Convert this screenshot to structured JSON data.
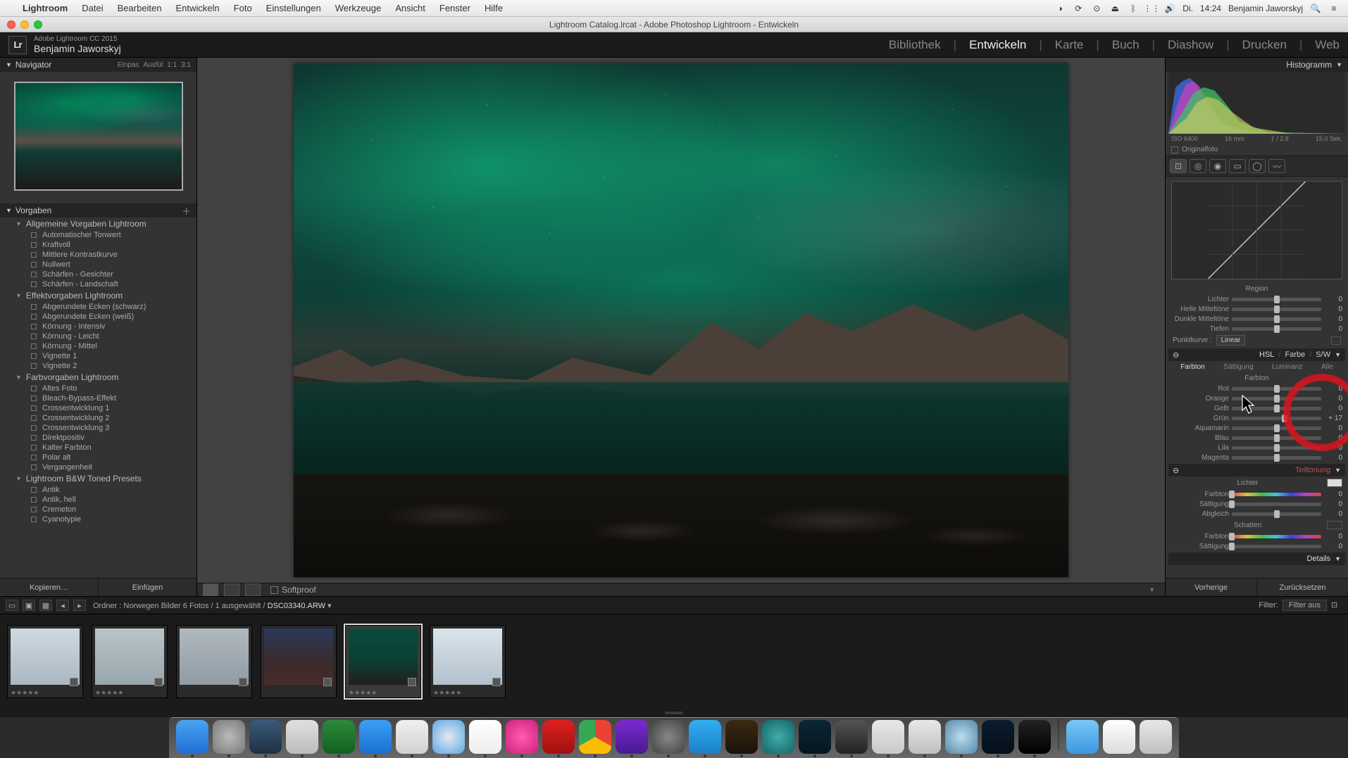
{
  "mac_menu": {
    "app": "Lightroom",
    "items": [
      "Datei",
      "Bearbeiten",
      "Entwickeln",
      "Foto",
      "Einstellungen",
      "Werkzeuge",
      "Ansicht",
      "Fenster",
      "Hilfe"
    ],
    "right": {
      "day": "Di.",
      "time": "14:24",
      "user": "Benjamin Jaworskyj"
    }
  },
  "window_title": "Lightroom Catalog.lrcat - Adobe Photoshop Lightroom - Entwickeln",
  "identity": {
    "line1": "Adobe Lightroom CC 2015",
    "line2": "Benjamin Jaworskyj",
    "logo_text": "Lr"
  },
  "modules": {
    "items": [
      "Bibliothek",
      "Entwickeln",
      "Karte",
      "Buch",
      "Diashow",
      "Drucken",
      "Web"
    ],
    "active": "Entwickeln"
  },
  "left": {
    "navigator_title": "Navigator",
    "zoom_labels": [
      "Einpas",
      "Ausfül",
      "1:1",
      "3:1"
    ],
    "presets_title": "Vorgaben",
    "groups": [
      {
        "name": "Allgemeine Vorgaben Lightroom",
        "items": [
          "Automatischer Tonwert",
          "Kraftvoll",
          "Mittlere Kontrastkurve",
          "Nullwert",
          "Schärfen - Gesichter",
          "Schärfen - Landschaft"
        ]
      },
      {
        "name": "Effektvorgaben Lightroom",
        "items": [
          "Abgerundete Ecken (schwarz)",
          "Abgerundete Ecken (weiß)",
          "Körnung - Intensiv",
          "Körnung - Leicht",
          "Körnung - Mittel",
          "Vignette 1",
          "Vignette 2"
        ]
      },
      {
        "name": "Farbvorgaben Lightroom",
        "items": [
          "Altes Foto",
          "Bleach-Bypass-Effekt",
          "Crossentwicklung 1",
          "Crossentwicklung 2",
          "Crossentwicklung 3",
          "Direktpositiv",
          "Kalter Farbton",
          "Polar alt",
          "Vergangenheit"
        ]
      },
      {
        "name": "Lightroom B&W Toned Presets",
        "items": [
          "Antik",
          "Antik, hell",
          "Cremeton",
          "Cyanotypie"
        ]
      }
    ],
    "btn_copy": "Kopieren…",
    "btn_paste": "Einfügen"
  },
  "center": {
    "softproof": "Softproof"
  },
  "path_bar": {
    "path_prefix": "Ordner : Norwegen Bilder  6 Fotos / 1 ausgewählt /",
    "filename": "DSC03340.ARW",
    "filter_label": "Filter:",
    "filter_value": "Filter aus"
  },
  "right": {
    "histogram_title": "Histogramm",
    "histo_info": {
      "iso": "ISO 6400",
      "focal": "16 mm",
      "aperture": "ƒ / 2.8",
      "shutter": "15,0 Sek."
    },
    "original_label": "Originalfoto",
    "tone_curve": {
      "region_title": "Region",
      "rows": [
        {
          "label": "Lichter",
          "val": "0"
        },
        {
          "label": "Helle Mitteltöne",
          "val": "0"
        },
        {
          "label": "Dunkle Mitteltöne",
          "val": "0"
        },
        {
          "label": "Tiefen",
          "val": "0"
        }
      ],
      "pk_label": "Punktkurve :",
      "pk_value": "Linear"
    },
    "hsl": {
      "header": {
        "hsl": "HSL",
        "farbe": "Farbe",
        "sw": "S/W"
      },
      "tabs": [
        "Farbton",
        "Sättigung",
        "Luminanz",
        "Alle"
      ],
      "active_tab": "Farbton",
      "sub_title": "Farbton",
      "rows": [
        {
          "label": "Rot",
          "val": "0",
          "cls": "hue-track-rot",
          "pos": 50
        },
        {
          "label": "Orange",
          "val": "0",
          "cls": "hue-track-orange",
          "pos": 50
        },
        {
          "label": "Gelb",
          "val": "0",
          "cls": "hue-track-gelb",
          "pos": 50
        },
        {
          "label": "Grün",
          "val": "+ 17",
          "cls": "hue-track-gruen",
          "pos": 59
        },
        {
          "label": "Aquamarin",
          "val": "0",
          "cls": "hue-track-aqua",
          "pos": 50
        },
        {
          "label": "Blau",
          "val": "0",
          "cls": "hue-track-blau",
          "pos": 50
        },
        {
          "label": "Lila",
          "val": "0",
          "cls": "hue-track-lila",
          "pos": 50
        },
        {
          "label": "Magenta",
          "val": "0",
          "cls": "hue-track-magenta",
          "pos": 50
        }
      ]
    },
    "split": {
      "header": "Teiltonung",
      "lights_title": "Lichter",
      "shadows_title": "Schatten",
      "hue_label": "Farbton",
      "sat_label": "Sättigung",
      "balance_label": "Abgleich",
      "zero": "0"
    },
    "details_header": "Details",
    "btn_prev": "Vorherige",
    "btn_reset": "Zurücksetzen"
  },
  "dock": {
    "apps": [
      {
        "name": "finder",
        "bg": "linear-gradient(#4aa3f0,#1f6fd6)"
      },
      {
        "name": "launchpad",
        "bg": "radial-gradient(circle at 50% 50%, #bbb, #777)"
      },
      {
        "name": "quicktime",
        "bg": "linear-gradient(#3a5a7a,#203040)"
      },
      {
        "name": "calculator",
        "bg": "linear-gradient(#e0e0e0,#bcbcbc)"
      },
      {
        "name": "excel",
        "bg": "linear-gradient(#2a8a3a,#126020)"
      },
      {
        "name": "appstore",
        "bg": "linear-gradient(#3aa0f5,#1a6ed0)"
      },
      {
        "name": "textedit",
        "bg": "linear-gradient(#f0f0f0,#d0d0d0)"
      },
      {
        "name": "safari",
        "bg": "radial-gradient(circle at 50% 50%, #e8e8ee, #5aa8e8)"
      },
      {
        "name": "calendar",
        "bg": "linear-gradient(#fff,#eee)"
      },
      {
        "name": "itunes",
        "bg": "radial-gradient(circle at 50% 50%, #ff5caa, #d02080)"
      },
      {
        "name": "filezilla",
        "bg": "linear-gradient(#e02020,#a01010)"
      },
      {
        "name": "chrome",
        "bg": "conic-gradient(#ea4335 0 120deg,#fbbc05 120deg 240deg,#34a853 240deg 360deg)"
      },
      {
        "name": "imovie",
        "bg": "linear-gradient(#7a2ad0,#4a1a90)"
      },
      {
        "name": "settings",
        "bg": "radial-gradient(circle at 50% 50%, #888,#444)"
      },
      {
        "name": "skype",
        "bg": "linear-gradient(#30b0f0,#1a80c8)"
      },
      {
        "name": "bridge",
        "bg": "linear-gradient(#3a2a10,#1a1208)"
      },
      {
        "name": "onepassword",
        "bg": "radial-gradient(circle at 50% 50%, #4aa,#166)"
      },
      {
        "name": "lightroom",
        "bg": "linear-gradient(#0a2636,#051620)"
      },
      {
        "name": "finalcut",
        "bg": "linear-gradient(#555,#222)"
      },
      {
        "name": "grab",
        "bg": "linear-gradient(#e8e8e8,#c8c8c8)"
      },
      {
        "name": "preview2",
        "bg": "linear-gradient(#e8e8e8,#c0c0c0)"
      },
      {
        "name": "dvd",
        "bg": "radial-gradient(circle at 50% 50%, #bde, #58a)"
      },
      {
        "name": "photoshop",
        "bg": "linear-gradient(#0a1c2e,#051018)"
      },
      {
        "name": "terminal",
        "bg": "linear-gradient(#222,#000)"
      }
    ],
    "right": [
      {
        "name": "downloads",
        "bg": "linear-gradient(#7ac8f5,#3a98e0)"
      },
      {
        "name": "pdf",
        "bg": "linear-gradient(#fff,#ddd)"
      },
      {
        "name": "trash",
        "bg": "linear-gradient(#e8e8e8,#c0c0c0)"
      }
    ]
  }
}
